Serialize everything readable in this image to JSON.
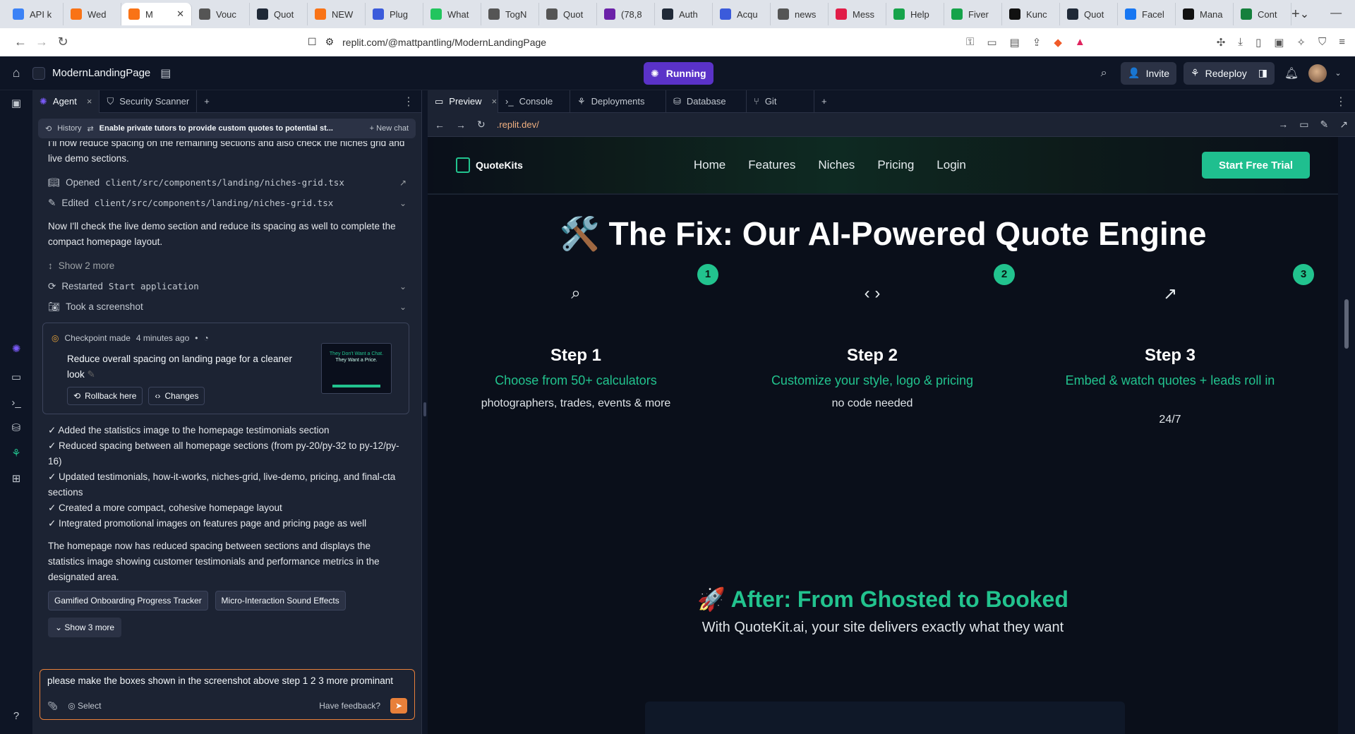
{
  "browser": {
    "tabs": [
      {
        "label": "API k",
        "color": "#3b82f6"
      },
      {
        "label": "Wed",
        "color": "#f97316"
      },
      {
        "label": "M",
        "color": "#f97316",
        "active": true
      },
      {
        "label": "Vouc",
        "color": "#555555"
      },
      {
        "label": "Quot",
        "color": "#1f2937"
      },
      {
        "label": "NEW",
        "color": "#f97316"
      },
      {
        "label": "Plug",
        "color": "#3b5bdb"
      },
      {
        "label": "What",
        "color": "#22c55e"
      },
      {
        "label": "TogN",
        "color": "#555555"
      },
      {
        "label": "Quot",
        "color": "#555555"
      },
      {
        "label": "(78,8",
        "color": "#6b21a8"
      },
      {
        "label": "Auth",
        "color": "#1f2937"
      },
      {
        "label": "Acqu",
        "color": "#3b5bdb"
      },
      {
        "label": "news",
        "color": "#555555"
      },
      {
        "label": "Mess",
        "color": "#e11d48"
      },
      {
        "label": "Help",
        "color": "#16a34a"
      },
      {
        "label": "Fiver",
        "color": "#16a34a"
      },
      {
        "label": "Kunc",
        "color": "#111111"
      },
      {
        "label": "Quot",
        "color": "#1f2937"
      },
      {
        "label": "Facel",
        "color": "#1877f2"
      },
      {
        "label": "Mana",
        "color": "#111111"
      },
      {
        "label": "Cont",
        "color": "#15803d"
      }
    ],
    "url": "replit.com/@mattpantling/ModernLandingPage"
  },
  "replit": {
    "project_name": "ModernLandingPage",
    "running_label": "Running",
    "invite_label": "Invite",
    "redeploy_label": "Redeploy"
  },
  "agent": {
    "tabs": [
      "Agent",
      "Security Scanner"
    ],
    "history_label": "History",
    "chat_title": "Enable private tutors to provide custom quotes to potential st...",
    "new_chat_label": "New chat",
    "messages": {
      "m1": "I'll now reduce spacing on the remaining sections and also check the niches grid and live demo sections.",
      "a1_label": "Opened",
      "a1_code": "client/src/components/landing/niches-grid.tsx",
      "a2_label": "Edited",
      "a2_code": "client/src/components/landing/niches-grid.tsx",
      "m2": "Now I'll check the live demo section and reduce its spacing as well to complete the compact homepage layout.",
      "show_more": "Show 2 more",
      "a3_label": "Restarted",
      "a3_code": "Start application",
      "a4_label": "Took a screenshot"
    },
    "checkpoint": {
      "head": "Checkpoint made",
      "time": "4 minutes ago",
      "text": "Reduce overall spacing on landing page for a cleaner look",
      "rollback_label": "Rollback here",
      "changes_label": "Changes",
      "thumb_line1": "They Don't Want a Chat.",
      "thumb_line2": "They Want a Price."
    },
    "summary": [
      "✓ Added the statistics image to the homepage testimonials section",
      "✓ Reduced spacing between all homepage sections (from py-20/py-32 to py-12/py-16)",
      "✓ Updated testimonials, how-it-works, niches-grid, live-demo, pricing, and final-cta sections",
      "✓ Created a more compact, cohesive homepage layout",
      "✓ Integrated promotional images on features page and pricing page as well"
    ],
    "closing": "The homepage now has reduced spacing between sections and displays the statistics image showing customer testimonials and performance metrics in the designated area.",
    "suggestions": [
      "Gamified Onboarding Progress Tracker",
      "Micro-Interaction Sound Effects"
    ],
    "show3": "Show 3 more",
    "composer_text": "please make the boxes shown in the screenshot above step 1 2 3 more prominant",
    "select_label": "Select",
    "feedback_label": "Have feedback?"
  },
  "preview": {
    "tabs": [
      "Preview",
      "Console",
      "Deployments",
      "Database",
      "Git"
    ],
    "url": ".replit.dev/"
  },
  "site": {
    "logo": "QuoteKits",
    "nav": [
      "Home",
      "Features",
      "Niches",
      "Pricing",
      "Login"
    ],
    "cta": "Start Free Trial",
    "fix_title": "🛠️ The Fix: Our AI-Powered Quote Engine",
    "steps": [
      {
        "num": "1",
        "title": "Step 1",
        "sub": "Choose from 50+ calculators",
        "desc": "photographers, trades, events & more"
      },
      {
        "num": "2",
        "title": "Step 2",
        "sub": "Customize your style, logo & pricing",
        "desc": "no code needed"
      },
      {
        "num": "3",
        "title": "Step 3",
        "sub": "Embed & watch quotes + leads roll in",
        "desc": "24/7"
      }
    ],
    "after_title": "🚀 After: From Ghosted to Booked",
    "after_sub": "With QuoteKit.ai, your site delivers exactly what they want"
  },
  "colors": {
    "accent": "#22c38e",
    "running": "#5a32c8",
    "composer_border": "#e8803a"
  }
}
